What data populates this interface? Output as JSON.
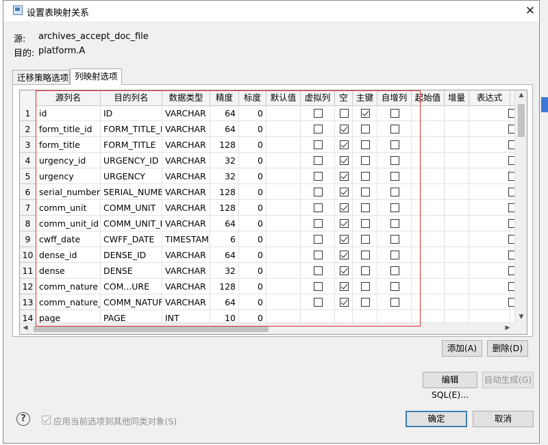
{
  "window": {
    "title": "设置表映射关系",
    "close_glyph": "✕"
  },
  "mapping": {
    "source_label": "源:",
    "source_value": "archives_accept_doc_file",
    "target_label": "目的:",
    "target_value": "platform.A"
  },
  "tabs": [
    {
      "label": "迁移策略选项",
      "active": false
    },
    {
      "label": "列映射选项",
      "active": true
    }
  ],
  "table": {
    "headers": [
      "",
      "源列名",
      "目的列名",
      "数据类型",
      "精度",
      "标度",
      "默认值",
      "虚拟列",
      "空",
      "主键",
      "自增列",
      "起始值",
      "增量",
      "表达式",
      ""
    ],
    "rows": [
      {
        "n": "1",
        "src": "id",
        "dst": "ID",
        "type": "VARCHAR",
        "precision": "64",
        "scale": "0",
        "virtual": false,
        "nullable": false,
        "pk": true,
        "autoinc": false
      },
      {
        "n": "2",
        "src": "form_title_id",
        "dst": "FORM_TITLE_I",
        "type": "VARCHAR",
        "precision": "64",
        "scale": "0",
        "virtual": false,
        "nullable": true,
        "pk": false,
        "autoinc": false
      },
      {
        "n": "3",
        "src": "form_title",
        "dst": "FORM_TITLE",
        "type": "VARCHAR",
        "precision": "128",
        "scale": "0",
        "virtual": false,
        "nullable": true,
        "pk": false,
        "autoinc": false
      },
      {
        "n": "4",
        "src": "urgency_id",
        "dst": "URGENCY_ID",
        "type": "VARCHAR",
        "precision": "32",
        "scale": "0",
        "virtual": false,
        "nullable": true,
        "pk": false,
        "autoinc": false
      },
      {
        "n": "5",
        "src": "urgency",
        "dst": "URGENCY",
        "type": "VARCHAR",
        "precision": "32",
        "scale": "0",
        "virtual": false,
        "nullable": true,
        "pk": false,
        "autoinc": false
      },
      {
        "n": "6",
        "src": "serial_number",
        "dst": "SERIAL_NUMB",
        "type": "VARCHAR",
        "precision": "128",
        "scale": "0",
        "virtual": false,
        "nullable": true,
        "pk": false,
        "autoinc": false
      },
      {
        "n": "7",
        "src": "comm_unit",
        "dst": "COMM_UNIT",
        "type": "VARCHAR",
        "precision": "128",
        "scale": "0",
        "virtual": false,
        "nullable": true,
        "pk": false,
        "autoinc": false
      },
      {
        "n": "8",
        "src": "comm_unit_id",
        "dst": "COMM_UNIT_I",
        "type": "VARCHAR",
        "precision": "64",
        "scale": "0",
        "virtual": false,
        "nullable": true,
        "pk": false,
        "autoinc": false
      },
      {
        "n": "9",
        "src": "cwff_date",
        "dst": "CWFF_DATE",
        "type": "TIMESTAM",
        "precision": "6",
        "scale": "0",
        "virtual": false,
        "nullable": true,
        "pk": false,
        "autoinc": false
      },
      {
        "n": "10",
        "src": "dense_id",
        "dst": "DENSE_ID",
        "type": "VARCHAR",
        "precision": "64",
        "scale": "0",
        "virtual": false,
        "nullable": true,
        "pk": false,
        "autoinc": false
      },
      {
        "n": "11",
        "src": "dense",
        "dst": "DENSE",
        "type": "VARCHAR",
        "precision": "32",
        "scale": "0",
        "virtual": false,
        "nullable": true,
        "pk": false,
        "autoinc": false
      },
      {
        "n": "12",
        "src": "comm_nature",
        "dst": "COM...URE",
        "type": "VARCHAR",
        "precision": "128",
        "scale": "0",
        "virtual": false,
        "nullable": true,
        "pk": false,
        "autoinc": false
      },
      {
        "n": "13",
        "src": "comm_nature_",
        "dst": "COMM_NATUF",
        "type": "VARCHAR",
        "precision": "64",
        "scale": "0",
        "virtual": false,
        "nullable": true,
        "pk": false,
        "autoinc": false
      },
      {
        "n": "14",
        "src": "page",
        "dst": "PAGE",
        "type": "INT",
        "precision": "10",
        "scale": "0",
        "virtual": null,
        "nullable": null,
        "pk": null,
        "autoinc": null
      }
    ]
  },
  "buttons": {
    "add": "添加(A)",
    "delete": "删除(D)",
    "edit_sql": "编辑SQL(E)...",
    "auto_generate": "自动生成(G)",
    "ok": "确定",
    "cancel": "取消"
  },
  "footer": {
    "help_glyph": "?",
    "apply_label": "应用当前选项到其他同类对象(S)",
    "apply_checked": true
  }
}
